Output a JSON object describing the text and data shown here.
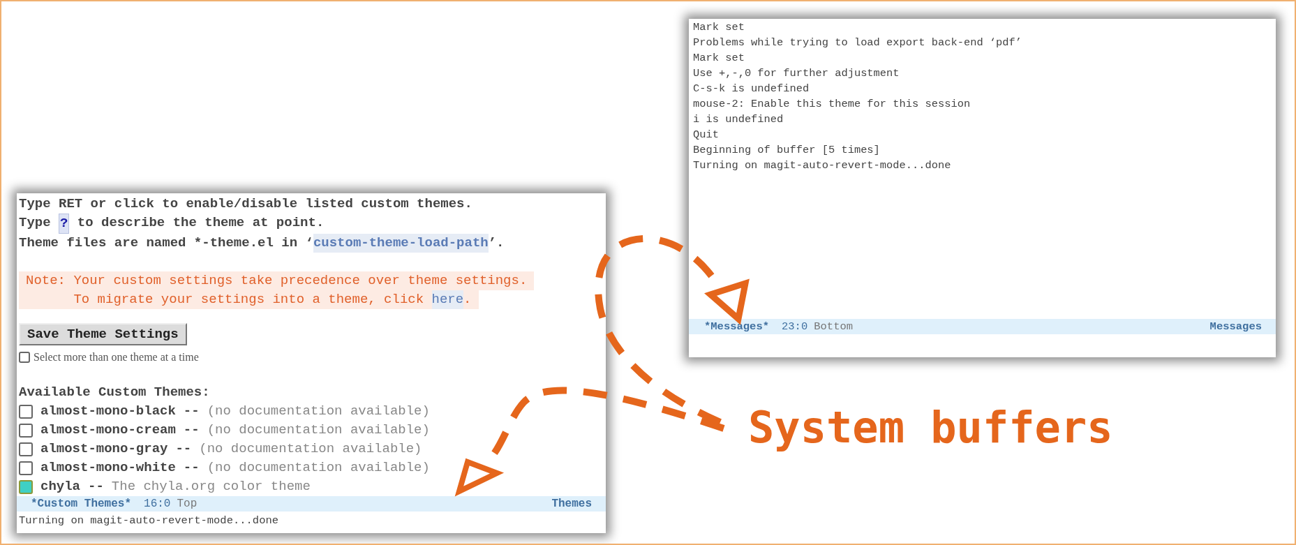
{
  "custom_themes_window": {
    "intro_lines": [
      [
        {
          "kind": "text",
          "text": "Type RET or click to enable/disable listed custom themes."
        }
      ],
      [
        {
          "kind": "text",
          "text": "Type "
        },
        {
          "kind": "key",
          "text": "?"
        },
        {
          "kind": "text",
          "text": " to describe the theme at point."
        }
      ],
      [
        {
          "kind": "text",
          "text": "Theme files are named *-theme.el in ‘"
        },
        {
          "kind": "link",
          "text": "custom-theme-load-path"
        },
        {
          "kind": "text",
          "text": "’."
        }
      ]
    ],
    "note_lines": [
      [
        {
          "kind": "text",
          "text": "Note: Your custom settings take precedence over theme settings."
        }
      ],
      [
        {
          "kind": "text",
          "text": "      To migrate your settings into a theme, click "
        },
        {
          "kind": "link",
          "text": "here"
        },
        {
          "kind": "text",
          "text": "."
        }
      ]
    ],
    "save_button": "Save Theme Settings",
    "multi_select": {
      "label": "Select more than one theme at a time",
      "checked": false
    },
    "heading": "Available Custom Themes:",
    "themes": [
      {
        "name": "almost-mono-black",
        "separator": "--",
        "description": "(no documentation available)",
        "checked": false
      },
      {
        "name": "almost-mono-cream",
        "separator": "--",
        "description": "(no documentation available)",
        "checked": false
      },
      {
        "name": "almost-mono-gray",
        "separator": "--",
        "description": "(no documentation available)",
        "checked": false
      },
      {
        "name": "almost-mono-white",
        "separator": "--",
        "description": "(no documentation available)",
        "checked": false
      },
      {
        "name": "chyla",
        "separator": "--",
        "description": "The chyla.org color theme",
        "checked": true
      }
    ],
    "mode_line": {
      "buffer": "*Custom Themes*",
      "position": "16:0",
      "scroll": "Top",
      "mode": "Themes"
    },
    "echo_area": "Turning on magit-auto-revert-mode...done"
  },
  "messages_window": {
    "lines": [
      "Mark set",
      "Problems while trying to load export back-end ‘pdf’",
      "Mark set",
      "Use +,-,0 for further adjustment",
      "C-s-k is undefined",
      "mouse-2: Enable this theme for this session",
      "i is undefined",
      "Quit",
      "Beginning of buffer [5 times]",
      "Turning on magit-auto-revert-mode...done"
    ],
    "mode_line": {
      "buffer": "*Messages*",
      "position": "23:0",
      "scroll": "Bottom",
      "mode": "Messages"
    }
  },
  "annotation": {
    "label": "System buffers"
  }
}
